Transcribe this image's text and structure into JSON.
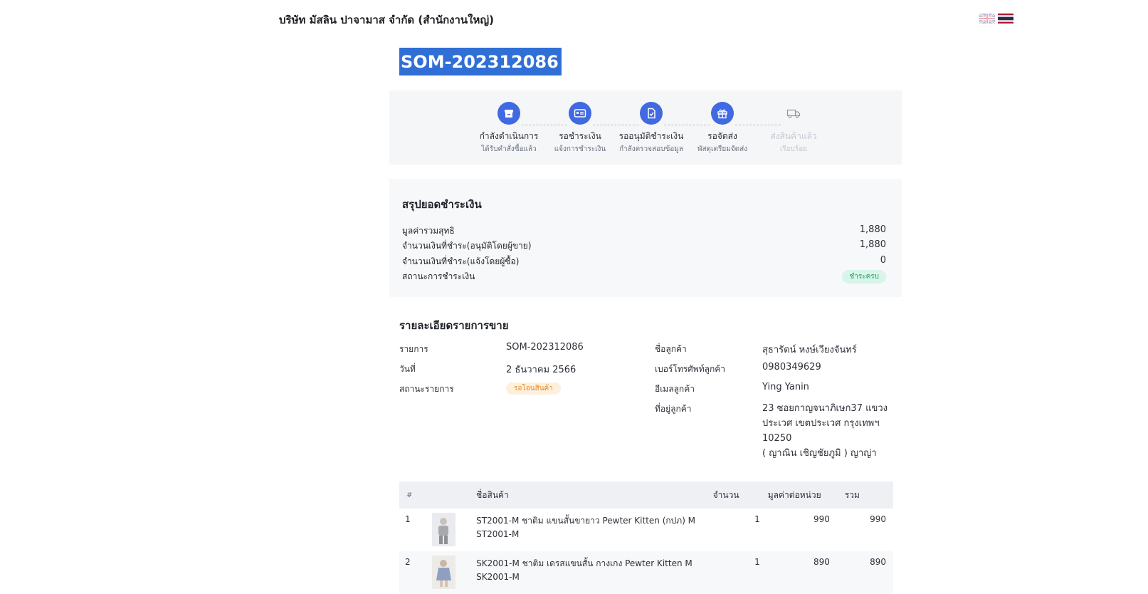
{
  "header": {
    "company": "บริษัท มัสลิน ปาจามาส จำกัด (สำนักงานใหญ่)",
    "flags": [
      "uk-flag-icon",
      "thai-flag-icon"
    ]
  },
  "order": {
    "id": "SOM-202312086"
  },
  "steps": [
    {
      "label": "กำลังดำเนินการ",
      "sub": "ได้รับคำสั่งซื้อแล้ว",
      "icon": "box-icon",
      "active": true
    },
    {
      "label": "รอชำระเงิน",
      "sub": "แจ้งการชำระเงิน",
      "icon": "payment-card-icon",
      "active": true
    },
    {
      "label": "รออนุมัติชำระเงิน",
      "sub": "กำลังตรวจสอบข้อมูล",
      "icon": "document-check-icon",
      "active": true
    },
    {
      "label": "รอจัดส่ง",
      "sub": "พัสดุเตรียมจัดส่ง",
      "icon": "gift-box-icon",
      "active": true
    },
    {
      "label": "ส่งสินค้าแล้ว",
      "sub": "เรียบร้อย",
      "icon": "truck-icon",
      "active": false
    }
  ],
  "summary": {
    "title": "สรุปยอดชำระเงิน",
    "rows": [
      {
        "label": "มูลค่ารวมสุทธิ",
        "value": "1,880"
      },
      {
        "label": "จำนวนเงินที่ชำระ(อนุมัติโดยผู้ขาย)",
        "value": "1,880"
      },
      {
        "label": "จำนวนเงินที่ชำระ(แจ้งโดยผู้ซื้อ)",
        "value": "0"
      }
    ],
    "status_label": "สถานะการชำระเงิน",
    "status_badge": "ชำระครบ"
  },
  "details": {
    "title": "รายละเอียดรายการขาย",
    "order_label": "รายการ",
    "order_value": "SOM-202312086",
    "date_label": "วันที่",
    "date_value": "2 ธันวาคม 2566",
    "status_label": "สถานะรายการ",
    "status_value": "รอโอนสินค้า",
    "customer_label": "ชื่อลูกค้า",
    "customer_value": "สุธารัตน์ หงษ์เวียงจันทร์",
    "phone_label": "เบอร์โทรศัพท์ลูกค้า",
    "phone_value": "0980349629",
    "email_label": "อีเมลลูกค้า",
    "email_value": "Ying Yanin",
    "address_label": "ที่อยู่ลูกค้า",
    "address_line1": "23 ซอยกาญจนาภิเษก37 แขวง ประเวศ เขตประเวศ กรุงเทพฯ 10250",
    "address_line2": "( ญาณิน เชิญชัยภูมิ ) ญาญ่า"
  },
  "items_table": {
    "headers": {
      "no": "#",
      "name": "ชื่อสินค้า",
      "qty": "จำนวน",
      "unit": "มูลค่าต่อหน่วย",
      "total": "รวม"
    },
    "rows": [
      {
        "no": "1",
        "name": "ST2001-M ชาติม แขนสั้นขายาว Pewter Kitten (กปภ) M",
        "sku": "ST2001-M",
        "qty": "1",
        "unit": "990",
        "total": "990"
      },
      {
        "no": "2",
        "name": "SK2001-M ชาติม เดรสแขนสั้น กางเกง Pewter Kitten M",
        "sku": "SK2001-M",
        "qty": "1",
        "unit": "890",
        "total": "890"
      }
    ]
  },
  "colors": {
    "accent": "#4169e1",
    "title_highlight": "#2f6fd6",
    "paid_badge": "#d8f5ea",
    "wait_badge": "#fdf0dc"
  }
}
